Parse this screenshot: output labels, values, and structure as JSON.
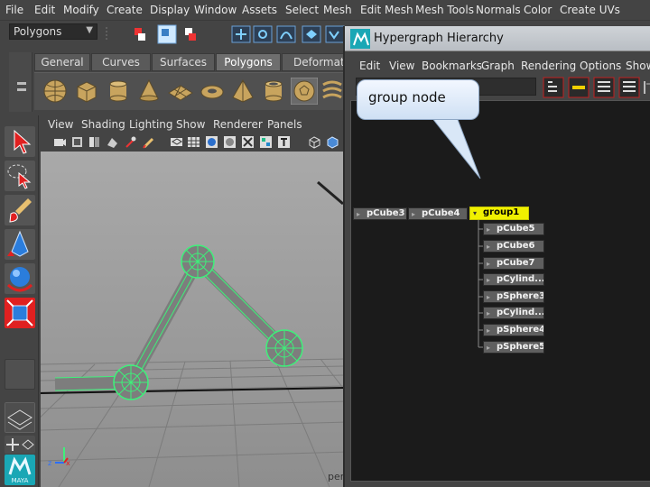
{
  "main_menu": {
    "items": [
      "File",
      "Edit",
      "Modify",
      "Create",
      "Display",
      "Window",
      "Assets",
      "Select",
      "Mesh",
      "Edit Mesh",
      "Mesh Tools",
      "Normals",
      "Color",
      "Create UVs"
    ]
  },
  "status_line": {
    "mode_value": "Polygons"
  },
  "shelf": {
    "tabs": [
      "General",
      "Curves",
      "Surfaces",
      "Polygons",
      "Deformation"
    ],
    "active_tab": "Polygons",
    "icons": [
      "sphere-icon",
      "cube-icon",
      "cylinder-icon",
      "cone-icon",
      "plane-icon",
      "torus-icon",
      "pyramid-icon",
      "pipe-icon",
      "soccer-ball-icon",
      "helix-icon"
    ]
  },
  "toolbox": {
    "tools": [
      "select-tool-icon",
      "lasso-tool-icon",
      "paint-select-icon",
      "move-tool-icon",
      "rotate-tool-icon",
      "scale-tool-icon",
      "layout-icon",
      "quad-layout-icon"
    ],
    "logo_text": "MAYA"
  },
  "panel": {
    "menu": [
      "View",
      "Shading",
      "Lighting",
      "Show",
      "Renderer",
      "Panels"
    ],
    "camera_label": "per"
  },
  "hypergraph": {
    "title": "Hypergraph Hierarchy",
    "menu": [
      "Edit",
      "View",
      "Bookmarks",
      "Graph",
      "Rendering",
      "Options",
      "Show"
    ],
    "top_nodes": [
      "pCube3",
      "pCube4",
      "group1"
    ],
    "selected_node": "group1",
    "children": [
      "pCube5",
      "pCube6",
      "pCube7",
      "pCylind...",
      "pSphere3",
      "pCylind...",
      "pSphere4",
      "pSphere5"
    ]
  },
  "callout": {
    "text": "group node"
  },
  "colors": {
    "selection_yellow": "#f0f000",
    "wireframe_green": "#3ef07a",
    "maya_teal": "#1aa7b5"
  }
}
